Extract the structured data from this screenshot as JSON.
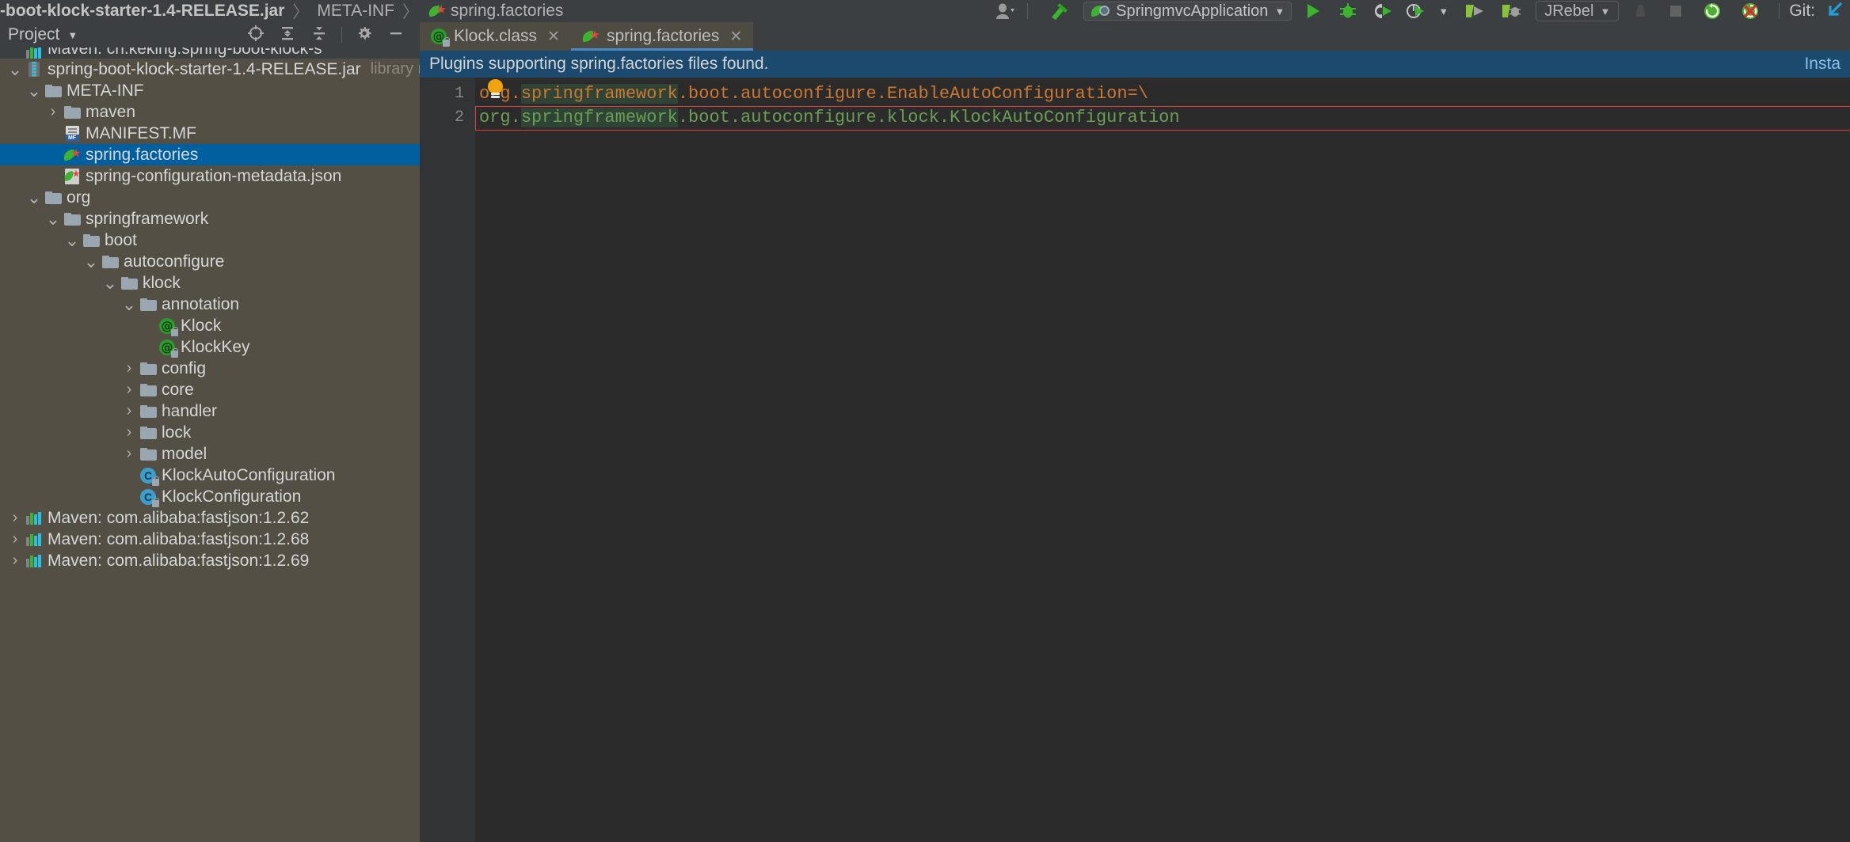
{
  "toolbar": {
    "breadcrumb": [
      {
        "label": "-boot-klock-starter-1.4-RELEASE.jar",
        "icon": "",
        "bold": true
      },
      {
        "label": "META-INF",
        "icon": "",
        "bold": false
      },
      {
        "label": "spring.factories",
        "icon": "spring-leaf-icon",
        "bold": false
      }
    ],
    "breadcrumb_separator": "〉",
    "user_icon": "user-icon",
    "build_icon": "build-hammer-icon",
    "run_config_name": "SpringmvcApplication",
    "run_config_icon": "spring-boot-icon",
    "dropdown_caret": "▼",
    "run_icon": "run-icon",
    "debug_icon": "debug-icon",
    "run_coverage_icon": "run-with-coverage-icon",
    "profiler_icon": "profiler-icon",
    "jrebel_run_icon": "jrebel-run-icon",
    "jrebel_debug_icon": "jrebel-debug-icon",
    "jrebel_label": "JRebel",
    "stop_icon": "stop-icon",
    "square_icon": "square-icon",
    "sync_icon": "sync-green-icon",
    "sync_error_icon": "sync-error-icon",
    "git_label": "Git:",
    "git_update_icon": "git-update-icon"
  },
  "project_panel": {
    "title": "Project",
    "title_caret": "▼",
    "header_icons": [
      "locate-icon",
      "expand-all-icon",
      "collapse-all-icon",
      "settings-gear-icon",
      "hide-icon"
    ],
    "tree": [
      {
        "label": "Maven: cn.keking:spring-boot-klock-s",
        "indent": 0,
        "arrow": "",
        "icon": "maven-lib-icon",
        "clipped": true,
        "selected": false,
        "dim": ""
      },
      {
        "label": "spring-boot-klock-starter-1.4-RELEASE.jar",
        "indent": 0,
        "arrow": "⌄",
        "icon": "jar-icon",
        "clipped": false,
        "selected": false,
        "dim": "library root"
      },
      {
        "label": "META-INF",
        "indent": 1,
        "arrow": "⌄",
        "icon": "folder-icon",
        "clipped": false,
        "selected": false,
        "dim": ""
      },
      {
        "label": "maven",
        "indent": 2,
        "arrow": "›",
        "icon": "folder-icon",
        "clipped": false,
        "selected": false,
        "dim": ""
      },
      {
        "label": "MANIFEST.MF",
        "indent": 2,
        "arrow": "",
        "icon": "manifest-file-icon",
        "clipped": false,
        "selected": false,
        "dim": ""
      },
      {
        "label": "spring.factories",
        "indent": 2,
        "arrow": "",
        "icon": "spring-factories-icon",
        "clipped": false,
        "selected": true,
        "dim": ""
      },
      {
        "label": "spring-configuration-metadata.json",
        "indent": 2,
        "arrow": "",
        "icon": "spring-json-icon",
        "clipped": false,
        "selected": false,
        "dim": ""
      },
      {
        "label": "org",
        "indent": 1,
        "arrow": "⌄",
        "icon": "folder-icon",
        "clipped": false,
        "selected": false,
        "dim": ""
      },
      {
        "label": "springframework",
        "indent": 2,
        "arrow": "⌄",
        "icon": "folder-icon",
        "clipped": false,
        "selected": false,
        "dim": ""
      },
      {
        "label": "boot",
        "indent": 3,
        "arrow": "⌄",
        "icon": "folder-icon",
        "clipped": false,
        "selected": false,
        "dim": ""
      },
      {
        "label": "autoconfigure",
        "indent": 4,
        "arrow": "⌄",
        "icon": "folder-icon",
        "clipped": false,
        "selected": false,
        "dim": ""
      },
      {
        "label": "klock",
        "indent": 5,
        "arrow": "⌄",
        "icon": "folder-icon",
        "clipped": false,
        "selected": false,
        "dim": ""
      },
      {
        "label": "annotation",
        "indent": 6,
        "arrow": "⌄",
        "icon": "folder-icon",
        "clipped": false,
        "selected": false,
        "dim": ""
      },
      {
        "label": "Klock",
        "indent": 7,
        "arrow": "",
        "icon": "annotation-class-icon",
        "clipped": false,
        "selected": false,
        "dim": ""
      },
      {
        "label": "KlockKey",
        "indent": 7,
        "arrow": "",
        "icon": "annotation-class-icon",
        "clipped": false,
        "selected": false,
        "dim": ""
      },
      {
        "label": "config",
        "indent": 6,
        "arrow": "›",
        "icon": "folder-icon",
        "clipped": false,
        "selected": false,
        "dim": ""
      },
      {
        "label": "core",
        "indent": 6,
        "arrow": "›",
        "icon": "folder-icon",
        "clipped": false,
        "selected": false,
        "dim": ""
      },
      {
        "label": "handler",
        "indent": 6,
        "arrow": "›",
        "icon": "folder-icon",
        "clipped": false,
        "selected": false,
        "dim": ""
      },
      {
        "label": "lock",
        "indent": 6,
        "arrow": "›",
        "icon": "folder-icon",
        "clipped": false,
        "selected": false,
        "dim": ""
      },
      {
        "label": "model",
        "indent": 6,
        "arrow": "›",
        "icon": "folder-icon",
        "clipped": false,
        "selected": false,
        "dim": ""
      },
      {
        "label": "KlockAutoConfiguration",
        "indent": 6,
        "arrow": "",
        "icon": "java-class-icon",
        "clipped": false,
        "selected": false,
        "dim": ""
      },
      {
        "label": "KlockConfiguration",
        "indent": 6,
        "arrow": "",
        "icon": "java-class-icon",
        "clipped": false,
        "selected": false,
        "dim": ""
      },
      {
        "label": "Maven: com.alibaba:fastjson:1.2.62",
        "indent": 0,
        "arrow": "›",
        "icon": "maven-lib-icon",
        "clipped": false,
        "selected": false,
        "dim": ""
      },
      {
        "label": "Maven: com.alibaba:fastjson:1.2.68",
        "indent": 0,
        "arrow": "›",
        "icon": "maven-lib-icon",
        "clipped": false,
        "selected": false,
        "dim": ""
      },
      {
        "label": "Maven: com.alibaba:fastjson:1.2.69",
        "indent": 0,
        "arrow": "›",
        "icon": "maven-lib-icon",
        "clipped": false,
        "selected": false,
        "dim": ""
      }
    ]
  },
  "editor": {
    "tabs": [
      {
        "label": "Klock.class",
        "icon": "annotation-class-icon",
        "active": false,
        "close": "✕"
      },
      {
        "label": "spring.factories",
        "icon": "spring-factories-icon",
        "active": true,
        "close": "✕"
      }
    ],
    "notification": {
      "message": "Plugins supporting spring.factories files found.",
      "action": "Insta"
    },
    "gutter_lines": [
      "1",
      "2"
    ],
    "code": [
      {
        "number": "1",
        "color": "#cc7832",
        "segments": [
          {
            "text": "org",
            "highlight": false
          },
          {
            "text": ".",
            "highlight": false
          },
          {
            "text": "springframework",
            "highlight": true
          },
          {
            "text": ".boot.autoconfigure.EnableAutoConfiguration=\\",
            "highlight": false
          }
        ]
      },
      {
        "number": "2",
        "color": "#6a9e55",
        "segments": [
          {
            "text": "org",
            "highlight": false
          },
          {
            "text": ".",
            "highlight": false
          },
          {
            "text": "springframework",
            "highlight": true
          },
          {
            "text": ".boot.autoconfigure.klock.KlockAutoConfiguration",
            "highlight": false
          }
        ]
      }
    ],
    "intention_bulb_icon": "intention-bulb-icon",
    "error_box_color": "#e0433b"
  },
  "colors": {
    "panel_bg": "#534f44",
    "toolbar_bg": "#3c3f41",
    "editor_bg": "#2b2b2b",
    "selection_blue": "#005f9e",
    "notification_blue": "#1b4a6e",
    "orange_text": "#cc7832",
    "green_text": "#6a9e55",
    "highlight_green": "#2f4434"
  }
}
